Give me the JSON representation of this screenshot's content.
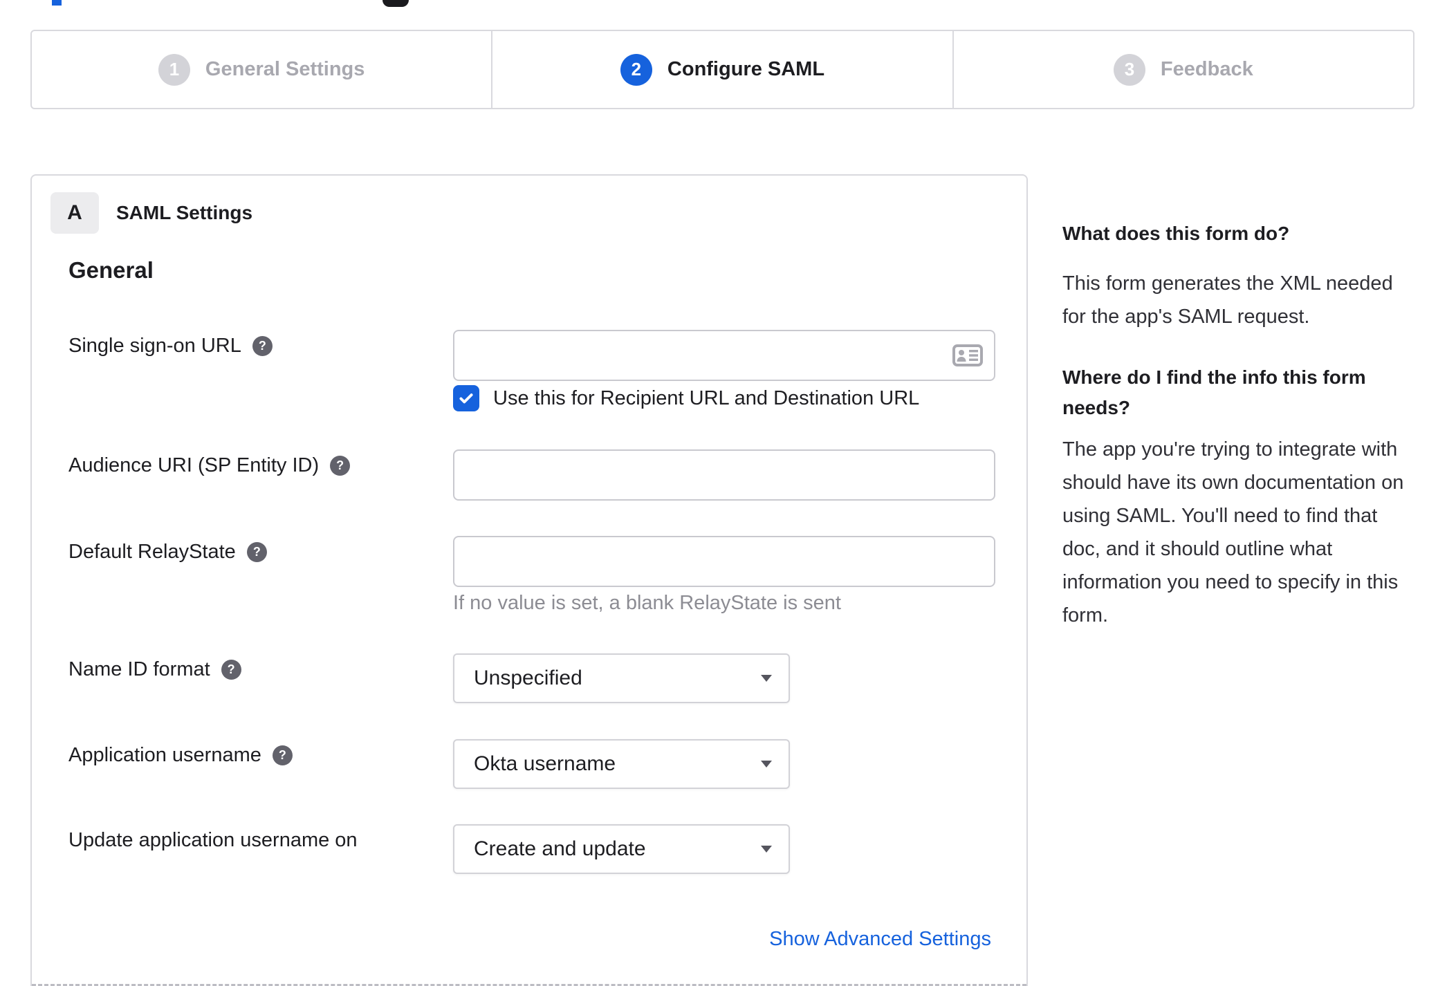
{
  "colors": {
    "accent": "#1662dd",
    "dark_text": "#1d1d21",
    "inactive_step": "#a8a8af",
    "border": "#d9d9de",
    "hint_text": "#8c8c93",
    "help_icon_bg": "#62626b",
    "link": "#1662dd"
  },
  "icons": {
    "help": "?",
    "step_check_style": "none",
    "contact_card": "contact-card-icon",
    "checkbox_check": "check-icon",
    "caret": "chevron-down"
  },
  "stepper": {
    "steps": [
      {
        "number": "1",
        "label": "General Settings",
        "state": "inactive"
      },
      {
        "number": "2",
        "label": "Configure SAML",
        "state": "active"
      },
      {
        "number": "3",
        "label": "Feedback",
        "state": "inactive"
      }
    ]
  },
  "panel": {
    "section_badge": "A",
    "section_title": "SAML Settings",
    "group_title": "General",
    "fields": {
      "sso": {
        "label": "Single sign-on URL",
        "value": "",
        "has_help": true
      },
      "sso_checkbox": {
        "label": "Use this for Recipient URL and Destination URL",
        "checked": true
      },
      "audience": {
        "label": "Audience URI (SP Entity ID)",
        "value": "",
        "has_help": true
      },
      "relay": {
        "label": "Default RelayState",
        "value": "",
        "has_help": true,
        "hint": "If no value is set, a blank RelayState is sent"
      },
      "name_id": {
        "label": "Name ID format",
        "value": "Unspecified",
        "has_help": true
      },
      "app_username": {
        "label": "Application username",
        "value": "Okta username",
        "has_help": true
      },
      "update_username": {
        "label": "Update application username on",
        "value": "Create and update",
        "has_help": false
      }
    },
    "advanced_link": "Show Advanced Settings"
  },
  "sidebar": {
    "sections": [
      {
        "heading": "What does this form do?",
        "body": "This form generates the XML needed for the app's SAML request."
      },
      {
        "heading": "Where do I find the info this form needs?",
        "body": "The app you're trying to integrate with should have its own documentation on using SAML. You'll need to find that doc, and it should outline what information you need to specify in this form."
      }
    ]
  }
}
